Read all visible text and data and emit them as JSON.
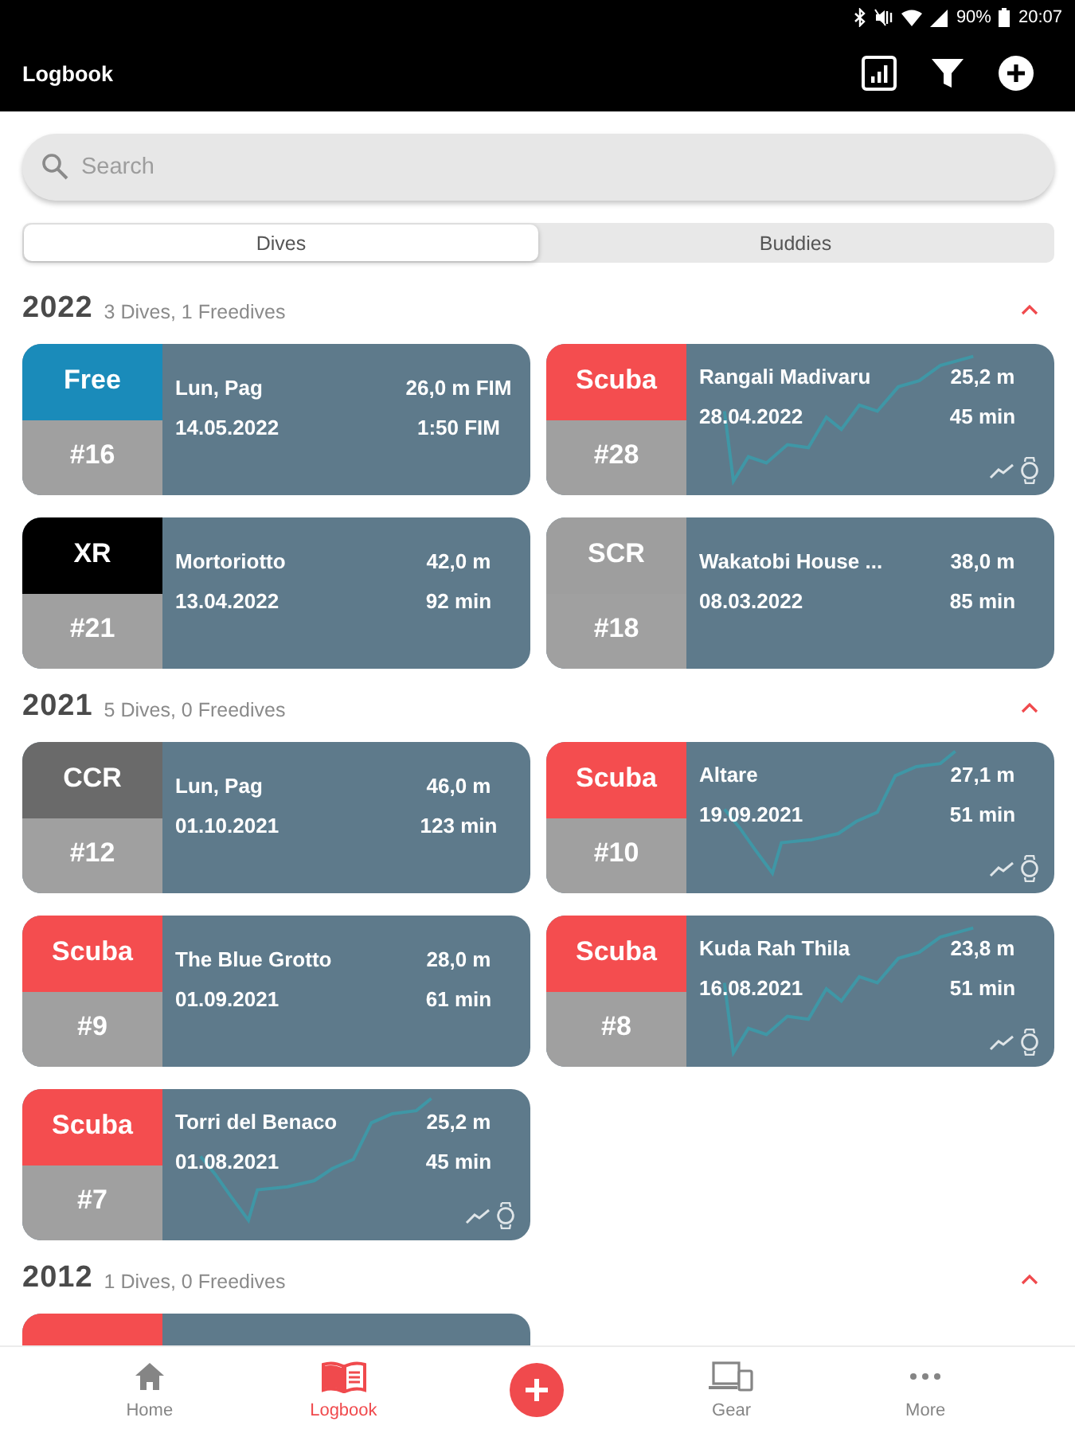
{
  "status_bar": {
    "battery": "90%",
    "time": "20:07"
  },
  "app_bar": {
    "title": "Logbook"
  },
  "search": {
    "placeholder": "Search"
  },
  "tabs": [
    {
      "label": "Dives",
      "selected": true
    },
    {
      "label": "Buddies",
      "selected": false
    }
  ],
  "sections": [
    {
      "year": "2022",
      "summary": "3 Dives, 1 Freedives",
      "expanded": true,
      "cards": [
        {
          "kind": "free",
          "type": "Free",
          "number": "#16",
          "site": "Lun, Pag",
          "date": "14.05.2022",
          "depth": "26,0 m FIM",
          "duration": "1:50 FIM",
          "profile": false,
          "cut_off": false
        },
        {
          "kind": "scuba",
          "type": "Scuba",
          "number": "#28",
          "site": "Rangali Madivaru",
          "date": "28.04.2022",
          "depth": "25,2 m",
          "duration": "45 min",
          "profile": true,
          "cut_off": false
        },
        {
          "kind": "xr",
          "type": "XR",
          "number": "#21",
          "site": "Mortoriotto",
          "date": "13.04.2022",
          "depth": "42,0 m",
          "duration": "92 min",
          "profile": false,
          "cut_off": false
        },
        {
          "kind": "scr",
          "type": "SCR",
          "number": "#18",
          "site": "Wakatobi House ...",
          "date": "08.03.2022",
          "depth": "38,0 m",
          "duration": "85 min",
          "profile": false,
          "cut_off": false
        }
      ]
    },
    {
      "year": "2021",
      "summary": "5 Dives, 0 Freedives",
      "expanded": true,
      "cards": [
        {
          "kind": "ccr",
          "type": "CCR",
          "number": "#12",
          "site": "Lun, Pag",
          "date": "01.10.2021",
          "depth": "46,0 m",
          "duration": "123 min",
          "profile": false,
          "cut_off": false
        },
        {
          "kind": "scuba",
          "type": "Scuba",
          "number": "#10",
          "site": "Altare",
          "date": "19.09.2021",
          "depth": "27,1 m",
          "duration": "51 min",
          "profile": true,
          "cut_off": false
        },
        {
          "kind": "scuba",
          "type": "Scuba",
          "number": "#9",
          "site": "The Blue Grotto",
          "date": "01.09.2021",
          "depth": "28,0 m",
          "duration": "61 min",
          "profile": false,
          "cut_off": false
        },
        {
          "kind": "scuba",
          "type": "Scuba",
          "number": "#8",
          "site": "Kuda Rah Thila",
          "date": "16.08.2021",
          "depth": "23,8 m",
          "duration": "51 min",
          "profile": true,
          "cut_off": false
        },
        {
          "kind": "scuba",
          "type": "Scuba",
          "number": "#7",
          "site": "Torri del Benaco",
          "date": "01.08.2021",
          "depth": "25,2 m",
          "duration": "45 min",
          "profile": true,
          "cut_off": false
        }
      ]
    },
    {
      "year": "2012",
      "summary": "1 Dives, 0 Freedives",
      "expanded": true,
      "cards": [
        {
          "kind": "scuba",
          "cut_off": true
        }
      ]
    }
  ],
  "nav": [
    {
      "kind": "home",
      "label": "Home",
      "selected": false
    },
    {
      "kind": "logbook",
      "label": "Logbook",
      "selected": true
    },
    {
      "kind": "add"
    },
    {
      "kind": "gear",
      "label": "Gear",
      "selected": false
    },
    {
      "kind": "more",
      "label": "More",
      "selected": false
    }
  ]
}
